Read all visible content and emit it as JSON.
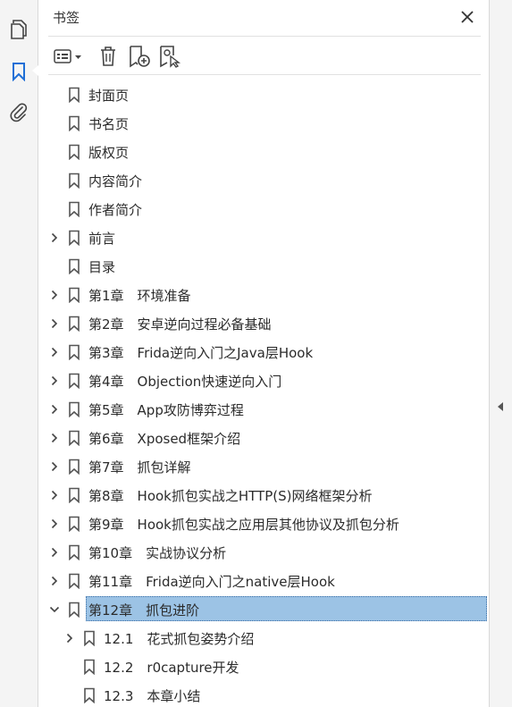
{
  "panel": {
    "title": "书签"
  },
  "icons": {
    "rail": [
      "pages-icon",
      "bookmarks-icon",
      "attachments-icon"
    ],
    "toolbar": [
      "options-menu-icon",
      "delete-icon",
      "new-bookmark-icon",
      "new-bookmark-from-structure-icon"
    ],
    "close": "close-icon",
    "collapse": "collapse-panel-icon"
  },
  "colors": {
    "selection": "#9cc3e5",
    "rail_active": "#1f6fd6"
  },
  "bookmarks": [
    {
      "label": "封面页",
      "level": 0,
      "expand": "none"
    },
    {
      "label": "书名页",
      "level": 0,
      "expand": "none"
    },
    {
      "label": "版权页",
      "level": 0,
      "expand": "none"
    },
    {
      "label": "内容简介",
      "level": 0,
      "expand": "none"
    },
    {
      "label": "作者简介",
      "level": 0,
      "expand": "none"
    },
    {
      "label": "前言",
      "level": 0,
      "expand": "collapsed"
    },
    {
      "label": "目录",
      "level": 0,
      "expand": "none"
    },
    {
      "label": "第1章　环境准备",
      "level": 0,
      "expand": "collapsed"
    },
    {
      "label": "第2章　安卓逆向过程必备基础",
      "level": 0,
      "expand": "collapsed"
    },
    {
      "label": "第3章　Frida逆向入门之Java层Hook",
      "level": 0,
      "expand": "collapsed"
    },
    {
      "label": "第4章　Objection快速逆向入门",
      "level": 0,
      "expand": "collapsed"
    },
    {
      "label": "第5章　App攻防博弈过程",
      "level": 0,
      "expand": "collapsed"
    },
    {
      "label": "第6章　Xposed框架介绍",
      "level": 0,
      "expand": "collapsed"
    },
    {
      "label": "第7章　抓包详解",
      "level": 0,
      "expand": "collapsed"
    },
    {
      "label": "第8章　Hook抓包实战之HTTP(S)网络框架分析",
      "level": 0,
      "expand": "collapsed"
    },
    {
      "label": "第9章　Hook抓包实战之应用层其他协议及抓包分析",
      "level": 0,
      "expand": "collapsed"
    },
    {
      "label": "第10章　实战协议分析",
      "level": 0,
      "expand": "collapsed"
    },
    {
      "label": "第11章　Frida逆向入门之native层Hook",
      "level": 0,
      "expand": "collapsed"
    },
    {
      "label": "第12章　抓包进阶",
      "level": 0,
      "expand": "expanded",
      "selected": true
    },
    {
      "label": "12.1　花式抓包姿势介绍",
      "level": 1,
      "expand": "collapsed"
    },
    {
      "label": "12.2　r0capture开发",
      "level": 1,
      "expand": "none"
    },
    {
      "label": "12.3　本章小结",
      "level": 1,
      "expand": "none"
    }
  ]
}
